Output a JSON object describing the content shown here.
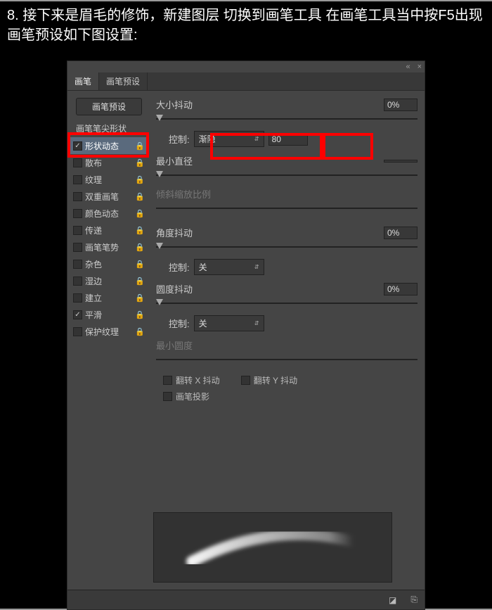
{
  "instruction": "8. 接下来是眉毛的修饰，新建图层 切换到画笔工具 在画笔工具当中按F5出现画笔预设如下图设置:",
  "tabs": {
    "brush": "画笔",
    "preset": "画笔预设"
  },
  "sidebar": {
    "preset_button": "画笔预设",
    "tip_shape": "画笔笔尖形状",
    "items": [
      {
        "label": "形状动态",
        "checked": true,
        "lock": true
      },
      {
        "label": "散布",
        "checked": false,
        "lock": true
      },
      {
        "label": "纹理",
        "checked": false,
        "lock": true
      },
      {
        "label": "双重画笔",
        "checked": false,
        "lock": true
      },
      {
        "label": "颜色动态",
        "checked": false,
        "lock": true
      },
      {
        "label": "传递",
        "checked": false,
        "lock": true
      },
      {
        "label": "画笔笔势",
        "checked": false,
        "lock": true
      },
      {
        "label": "杂色",
        "checked": false,
        "lock": true
      },
      {
        "label": "湿边",
        "checked": false,
        "lock": true
      },
      {
        "label": "建立",
        "checked": false,
        "lock": true
      },
      {
        "label": "平滑",
        "checked": true,
        "lock": true
      },
      {
        "label": "保护纹理",
        "checked": false,
        "lock": true
      }
    ]
  },
  "settings": {
    "size_jitter": {
      "label": "大小抖动",
      "value": "0%"
    },
    "control1": {
      "label": "控制:",
      "value": "渐隐",
      "count": "80"
    },
    "min_diameter": {
      "label": "最小直径",
      "value": ""
    },
    "tilt_scale": {
      "label": "倾斜缩放比例"
    },
    "angle_jitter": {
      "label": "角度抖动",
      "value": "0%"
    },
    "control2": {
      "label": "控制:",
      "value": "关"
    },
    "roundness_jitter": {
      "label": "圆度抖动",
      "value": "0%"
    },
    "control3": {
      "label": "控制:",
      "value": "关"
    },
    "min_roundness": {
      "label": "最小圆度"
    },
    "flip_x": "翻转 X 抖动",
    "flip_y": "翻转 Y 抖动",
    "projection": "画笔投影"
  }
}
